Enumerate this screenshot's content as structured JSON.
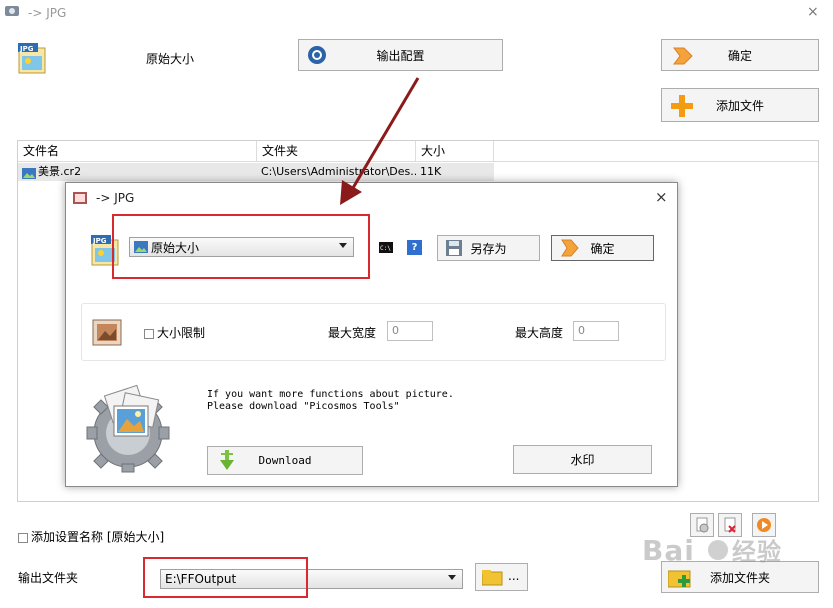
{
  "window": {
    "title": "-> JPG",
    "close_glyph": "×"
  },
  "main": {
    "size_label": "原始大小",
    "output_config_button": "输出配置",
    "confirm_button": "确定",
    "add_file_button": "添加文件",
    "table": {
      "headers": [
        "文件名",
        "文件夹",
        "大小"
      ],
      "rows": [
        {
          "name": "美景.cr2",
          "folder": "C:\\Users\\Administrator\\Des...",
          "size": "11K"
        }
      ]
    },
    "add_setting_name_label": "添加设置名称 [原始大小]",
    "output_folder_label": "输出文件夹",
    "output_folder_value": "E:\\FFOutput",
    "browse_button": "...",
    "add_folder_button": "添加文件夹"
  },
  "dialog": {
    "title": "-> JPG",
    "close_glyph": "×",
    "size_combo_value": "原始大小",
    "help_glyph": "?",
    "save_as_button": "另存为",
    "confirm_button": "确定",
    "size_limit_label": "大小限制",
    "max_width_label": "最大宽度",
    "max_width_value": "0",
    "max_height_label": "最大高度",
    "max_height_value": "0",
    "promo_line1": "If you want more functions about picture.",
    "promo_line2": "Please download \"Picosmos Tools\"",
    "download_button": "Download",
    "watermark_button": "水印"
  },
  "colors": {
    "highlight_red": "#d9292e",
    "arrow_red": "#8b1a1a",
    "add_orange": "#f39c12"
  }
}
